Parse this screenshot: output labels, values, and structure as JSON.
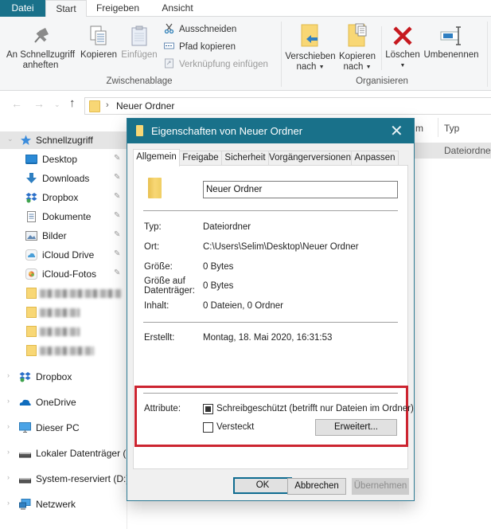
{
  "ribbon": {
    "tabs": [
      {
        "label": "Datei"
      },
      {
        "label": "Start"
      },
      {
        "label": "Freigeben"
      },
      {
        "label": "Ansicht"
      }
    ],
    "active_tab": "Start",
    "clipboard": {
      "group_label": "Zwischenablage",
      "pin_label_line1": "An Schnellzugriff",
      "pin_label_line2": "anheften",
      "copy_label": "Kopieren",
      "paste_label": "Einfügen",
      "cut_label": "Ausschneiden",
      "copy_path_label": "Pfad kopieren",
      "paste_shortcut_label": "Verknüpfung einfügen"
    },
    "organize": {
      "group_label": "Organisieren",
      "move_to_line1": "Verschieben",
      "move_to_line2": "nach",
      "copy_to_line1": "Kopieren",
      "copy_to_line2": "nach",
      "delete_label": "Löschen",
      "rename_label": "Umbenennen"
    }
  },
  "address_bar": {
    "separator": "›",
    "path": "Neuer Ordner"
  },
  "nav_buttons": {
    "back": "←",
    "forward": "→",
    "recent": "⌄",
    "up": "↑"
  },
  "sidebar": {
    "quick_access": {
      "label": "Schnellzugriff"
    },
    "pinned": [
      {
        "label": "Desktop",
        "icon": "desktop-icon"
      },
      {
        "label": "Downloads",
        "icon": "downloads-icon"
      },
      {
        "label": "Dropbox",
        "icon": "dropbox-icon"
      },
      {
        "label": "Dokumente",
        "icon": "documents-icon"
      },
      {
        "label": "Bilder",
        "icon": "pictures-icon"
      },
      {
        "label": "iCloud Drive",
        "icon": "icloud-drive-icon"
      },
      {
        "label": "iCloud-Fotos",
        "icon": "icloud-photos-icon"
      }
    ],
    "pin_glyph": "📌",
    "blurred_folders_count": 4,
    "roots": [
      {
        "label": "Dropbox",
        "icon": "dropbox-icon"
      },
      {
        "label": "OneDrive",
        "icon": "onedrive-icon"
      },
      {
        "label": "Dieser PC",
        "icon": "this-pc-icon"
      },
      {
        "label": "Lokaler Datenträger (",
        "icon": "drive-icon"
      },
      {
        "label": "System-reserviert (D:)",
        "icon": "drive-icon"
      },
      {
        "label": "Netzwerk",
        "icon": "network-icon"
      }
    ]
  },
  "file_list": {
    "columns": {
      "name_partial": "m",
      "type": "Typ"
    },
    "rows": [
      {
        "type": "Dateiordner"
      }
    ]
  },
  "dialog": {
    "title": "Eigenschaften von Neuer Ordner",
    "close_glyph": "✕",
    "tabs": [
      {
        "label": "Allgemein"
      },
      {
        "label": "Freigabe"
      },
      {
        "label": "Sicherheit"
      },
      {
        "label": "Vorgängerversionen"
      },
      {
        "label": "Anpassen"
      }
    ],
    "active_tab": "Allgemein",
    "folder_name": "Neuer Ordner",
    "properties": {
      "type_label": "Typ:",
      "type_value": "Dateiordner",
      "location_label": "Ort:",
      "location_value": "C:\\Users\\Selim\\Desktop\\Neuer Ordner",
      "size_label": "Größe:",
      "size_value": "0 Bytes",
      "size_on_disk_label_line1": "Größe auf",
      "size_on_disk_label_line2": "Datenträger:",
      "size_on_disk_value": "0 Bytes",
      "contents_label": "Inhalt:",
      "contents_value": "0 Dateien, 0 Ordner",
      "created_label": "Erstellt:",
      "created_value": "Montag, 18. Mai 2020, 16:31:53"
    },
    "attributes": {
      "label": "Attribute:",
      "readonly_label": "Schreibgeschützt (betrifft nur Dateien im Ordner)",
      "readonly_state": "indeterminate",
      "hidden_label": "Versteckt",
      "hidden_state": "unchecked",
      "advanced_button": "Erweitert..."
    },
    "highlight_color": "#cc2430",
    "buttons": {
      "ok": "OK",
      "cancel": "Abbrechen",
      "apply": "Übernehmen"
    }
  },
  "colors": {
    "accent": "#19718a",
    "highlight_border": "#cc2430",
    "folder_yellow": "#f8d775"
  }
}
